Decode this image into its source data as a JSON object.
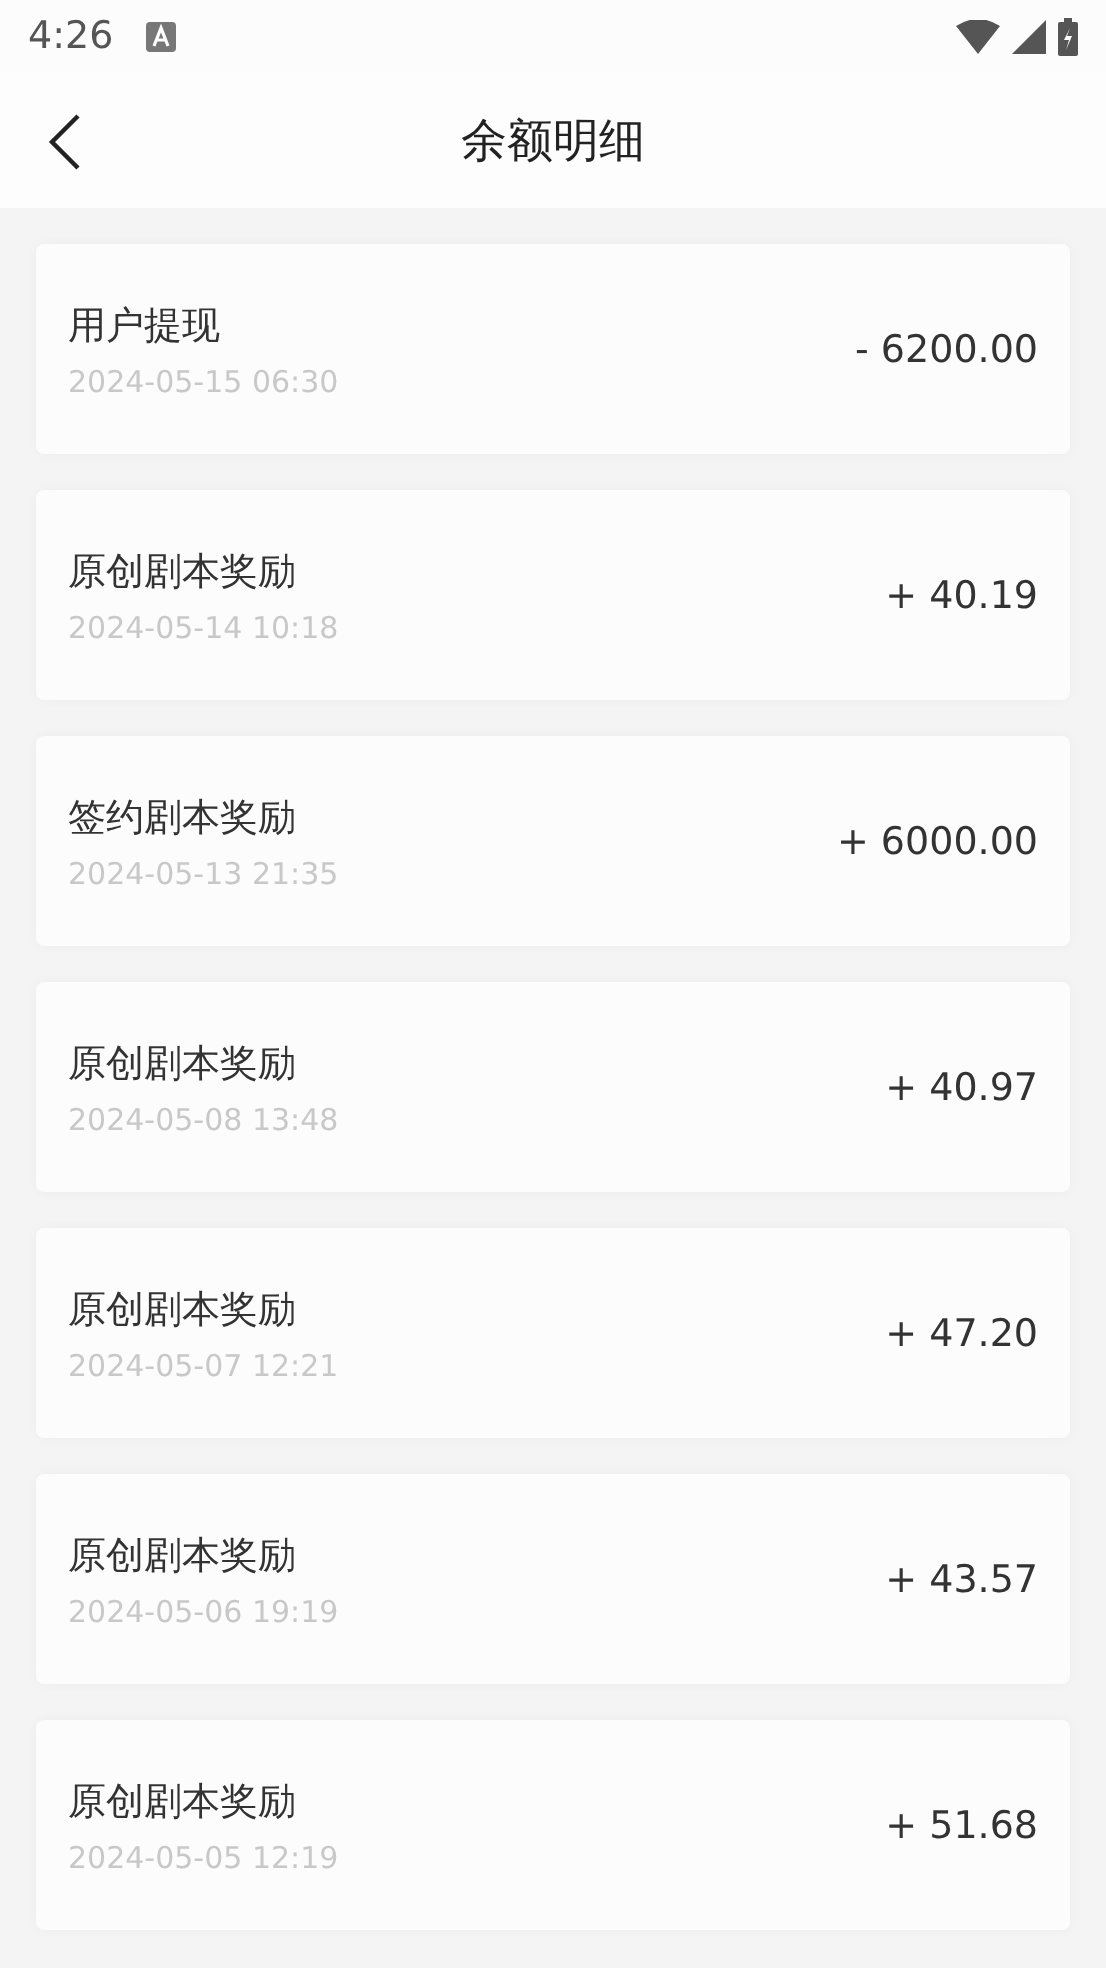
{
  "status_bar": {
    "time": "4:26"
  },
  "header": {
    "title": "余额明细"
  },
  "records": [
    {
      "title": "用户提现",
      "time": "2024-05-15 06:30",
      "amount": "- 6200.00"
    },
    {
      "title": "原创剧本奖励",
      "time": "2024-05-14 10:18",
      "amount": "+ 40.19"
    },
    {
      "title": "签约剧本奖励",
      "time": "2024-05-13 21:35",
      "amount": "+ 6000.00"
    },
    {
      "title": "原创剧本奖励",
      "time": "2024-05-08 13:48",
      "amount": "+ 40.97"
    },
    {
      "title": "原创剧本奖励",
      "time": "2024-05-07 12:21",
      "amount": "+ 47.20"
    },
    {
      "title": "原创剧本奖励",
      "time": "2024-05-06 19:19",
      "amount": "+ 43.57"
    },
    {
      "title": "原创剧本奖励",
      "time": "2024-05-05 12:19",
      "amount": "+ 51.68"
    }
  ]
}
